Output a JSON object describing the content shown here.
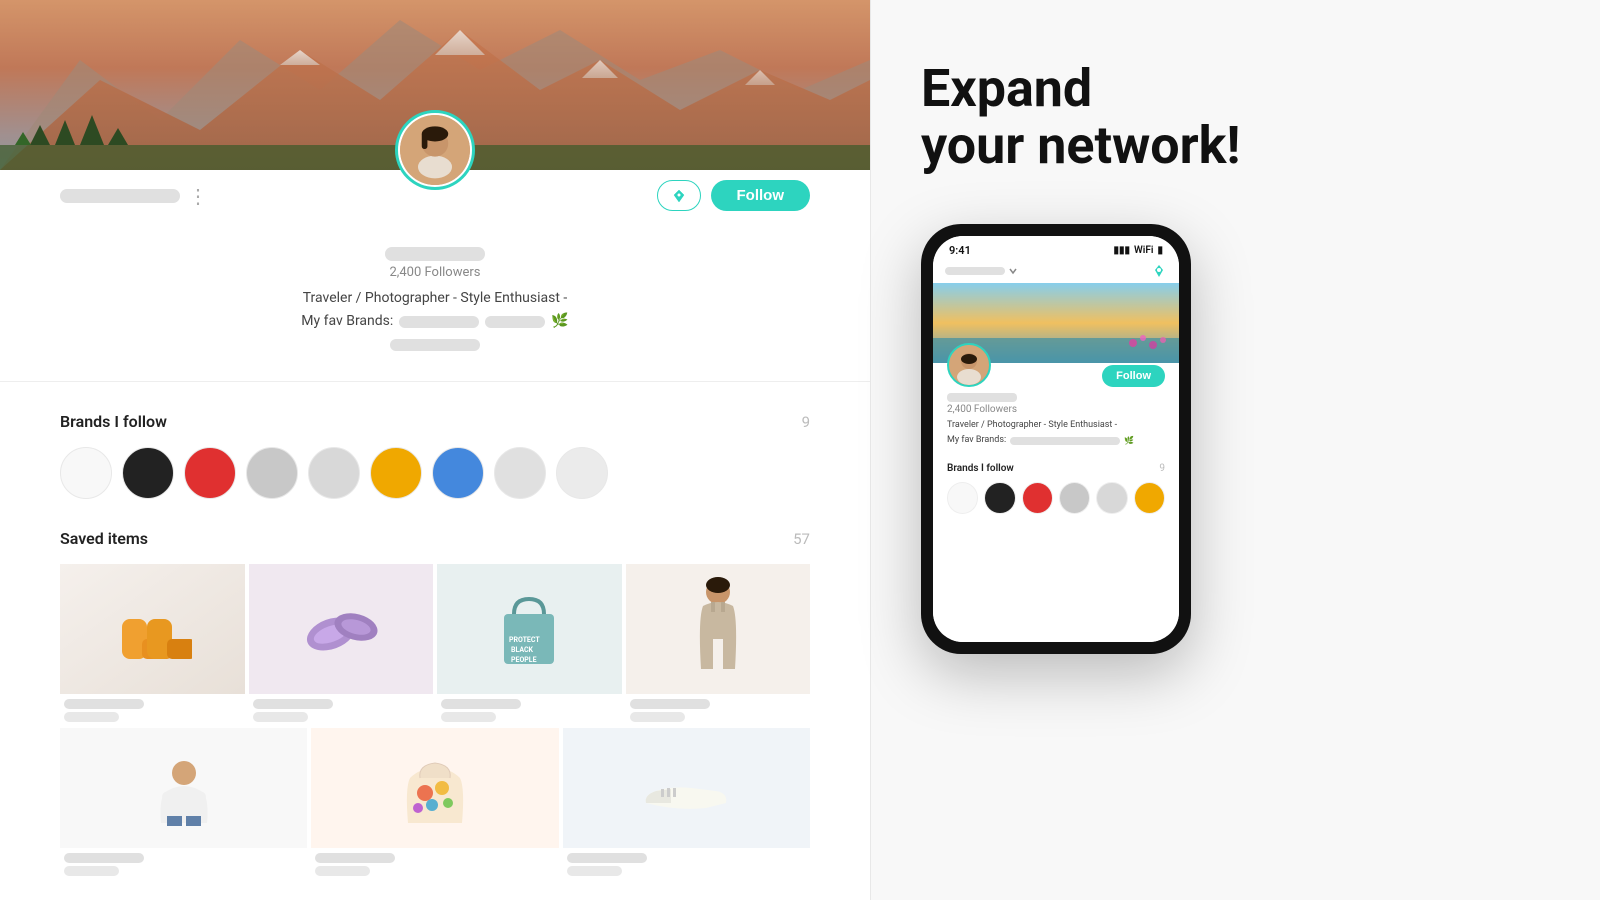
{
  "profile": {
    "name_blurred": true,
    "followers_count": "2,400 Followers",
    "bio_line1": "Traveler / Photographer - Style Enthusiast -",
    "bio_line2": "My fav Brands:",
    "follow_button": "Follow",
    "location_icon": "📍"
  },
  "brands": {
    "title": "Brands I follow",
    "count": "9",
    "items": [
      {
        "color": "white",
        "class": "bc-white"
      },
      {
        "color": "black",
        "class": "bc-black"
      },
      {
        "color": "red",
        "class": "bc-red"
      },
      {
        "color": "gray1",
        "class": "bc-gray1"
      },
      {
        "color": "gray2",
        "class": "bc-gray2"
      },
      {
        "color": "orange",
        "class": "bc-orange"
      },
      {
        "color": "blue",
        "class": "bc-blue"
      },
      {
        "color": "lgray",
        "class": "bc-lgray"
      },
      {
        "color": "llgray",
        "class": "bc-llgray"
      }
    ]
  },
  "saved_items": {
    "title": "Saved items",
    "count": "57"
  },
  "right_panel": {
    "heading_line1": "Expand",
    "heading_line2": "your network!"
  },
  "phone": {
    "time": "9:41",
    "followers": "2,400 Followers",
    "bio": "Traveler / Photographer - Style Enthusiast -",
    "bio_brands": "My fav Brands:",
    "follow_label": "Follow",
    "brands_title": "Brands I follow",
    "brands_count": "9"
  }
}
